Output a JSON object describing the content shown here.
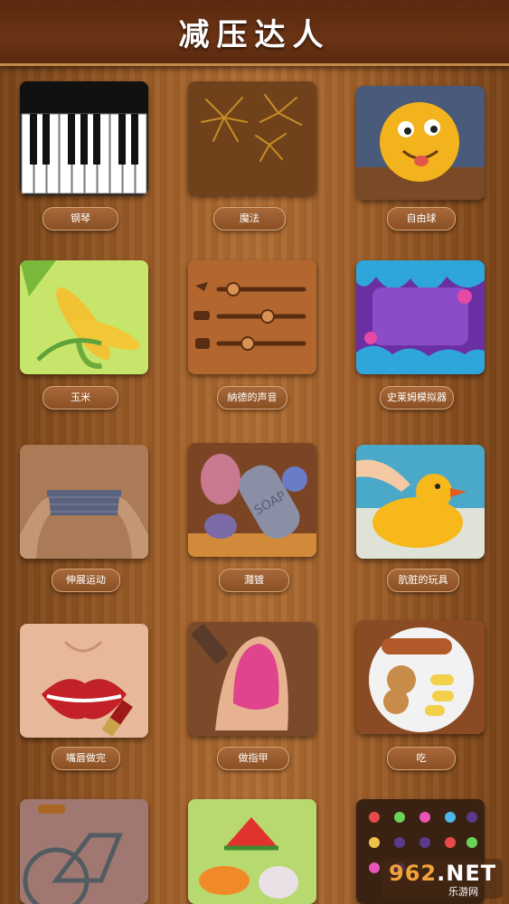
{
  "header": {
    "title": "减压达人"
  },
  "games": [
    {
      "id": "piano",
      "label": "钢琴",
      "icon": "piano-keys-icon"
    },
    {
      "id": "magic",
      "label": "魔法",
      "icon": "fireworks-icon"
    },
    {
      "id": "ball",
      "label": "自由球",
      "icon": "emoji-ball-icon"
    },
    {
      "id": "corn",
      "label": "玉米",
      "icon": "corn-icon"
    },
    {
      "id": "sound",
      "label": "納德的声音",
      "icon": "sound-sliders-icon"
    },
    {
      "id": "slime",
      "label": "史莱姆模拟器",
      "icon": "slime-icon"
    },
    {
      "id": "stretch",
      "label": "伸展运动",
      "icon": "stretch-fabric-icon"
    },
    {
      "id": "plating",
      "label": "濺镀",
      "icon": "soap-plating-icon"
    },
    {
      "id": "dirty",
      "label": "肮脏的玩具",
      "icon": "rubber-duck-icon"
    },
    {
      "id": "lips",
      "label": "嘴唇做完",
      "icon": "lipstick-icon"
    },
    {
      "id": "nail",
      "label": "做指甲",
      "icon": "nail-polish-icon"
    },
    {
      "id": "eat",
      "label": "吃",
      "icon": "food-plate-icon"
    },
    {
      "id": "bike",
      "label": "",
      "icon": "bicycle-icon"
    },
    {
      "id": "fruit",
      "label": "",
      "icon": "fruit-icon"
    },
    {
      "id": "dots",
      "label": "",
      "icon": "dots-board-icon"
    }
  ],
  "watermark": {
    "brand_main": "962",
    "brand_suffix": ".NET",
    "site_name": "乐游网"
  }
}
